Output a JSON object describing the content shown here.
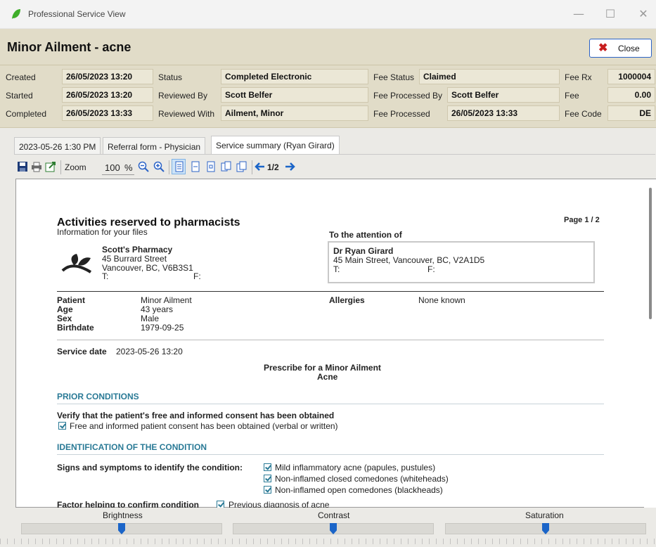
{
  "window": {
    "title": "Professional Service View"
  },
  "header": {
    "service_title": "Minor Ailment - acne",
    "close_label": "Close",
    "rows": [
      {
        "created_label": "Created",
        "created": "26/05/2023 13:20",
        "status_label": "Status",
        "status": "Completed Electronic",
        "fee_status_label": "Fee Status",
        "fee_status": "Claimed",
        "fee_rx_label": "Fee Rx",
        "fee_rx": "1000004"
      },
      {
        "started_label": "Started",
        "started": "26/05/2023 13:20",
        "reviewed_by_label": "Reviewed By",
        "reviewed_by": "Scott Belfer",
        "fee_processed_by_label": "Fee Processed By",
        "fee_processed_by": "Scott Belfer",
        "fee_label": "Fee",
        "fee": "0.00"
      },
      {
        "completed_label": "Completed",
        "completed": "26/05/2023 13:33",
        "reviewed_with_label": "Reviewed With",
        "reviewed_with": "Ailment, Minor",
        "fee_processed_label": "Fee Processed",
        "fee_processed": "26/05/2023 13:33",
        "fee_code_label": "Fee Code",
        "fee_code": "DE"
      }
    ]
  },
  "tabs": [
    {
      "label": "2023-05-26 1:30 PM"
    },
    {
      "label": "Referral form - Physician"
    },
    {
      "label": "Service summary (Ryan Girard)"
    }
  ],
  "toolbar": {
    "zoom_label": "Zoom",
    "zoom_value": "100",
    "zoom_unit": "%",
    "page_indicator": "1/2"
  },
  "document": {
    "title": "Activities reserved to pharmacists",
    "subtitle": "Information for your files",
    "page_label": "Page 1 / 2",
    "attention_label": "To the attention of",
    "pharmacy": {
      "name": "Scott's Pharmacy",
      "street": "45 Burrard Street",
      "city": "Vancouver, BC, V6B3S1",
      "t_label": "T:",
      "f_label": "F:"
    },
    "doctor": {
      "name": "Dr Ryan Girard",
      "address": "45 Main Street, Vancouver, BC, V2A1D5",
      "t_label": "T:",
      "f_label": "F:"
    },
    "patient": {
      "patient_label": "Patient",
      "patient": "Minor Ailment",
      "age_label": "Age",
      "age": "43 years",
      "sex_label": "Sex",
      "sex": "Male",
      "birthdate_label": "Birthdate",
      "birthdate": "1979-09-25",
      "allergies_label": "Allergies",
      "allergies": "None known"
    },
    "service_date_label": "Service date",
    "service_date": "2023-05-26 13:20",
    "prescribe_line1": "Prescribe for a Minor Ailment",
    "prescribe_line2": "Acne",
    "prior_conditions": {
      "heading": "PRIOR CONDITIONS",
      "question": "Verify that the patient's free and informed consent has been obtained",
      "answer": "Free and informed patient consent has been obtained (verbal or written)"
    },
    "identification": {
      "heading": "IDENTIFICATION OF THE CONDITION",
      "signs_label": "Signs and symptoms to identify the condition:",
      "signs": [
        "Mild inflammatory acne (papules, pustules)",
        "Non-inflamed closed comedones (whiteheads)",
        "Non-inflamed open comedones (blackheads)"
      ],
      "factor_label": "Factor helping to confirm condition",
      "factor": "Previous diagnosis of acne"
    }
  },
  "sliders": {
    "brightness": {
      "label": "Brightness",
      "level": 0.5
    },
    "contrast": {
      "label": "Contrast",
      "level": 0.5
    },
    "saturation": {
      "label": "Saturation",
      "level": 0.5
    }
  },
  "colors": {
    "header_bg": "#e1dcc8",
    "accent_blue": "#1b65c8",
    "section_teal": "#2a7a96",
    "close_x": "#c81e1e"
  }
}
